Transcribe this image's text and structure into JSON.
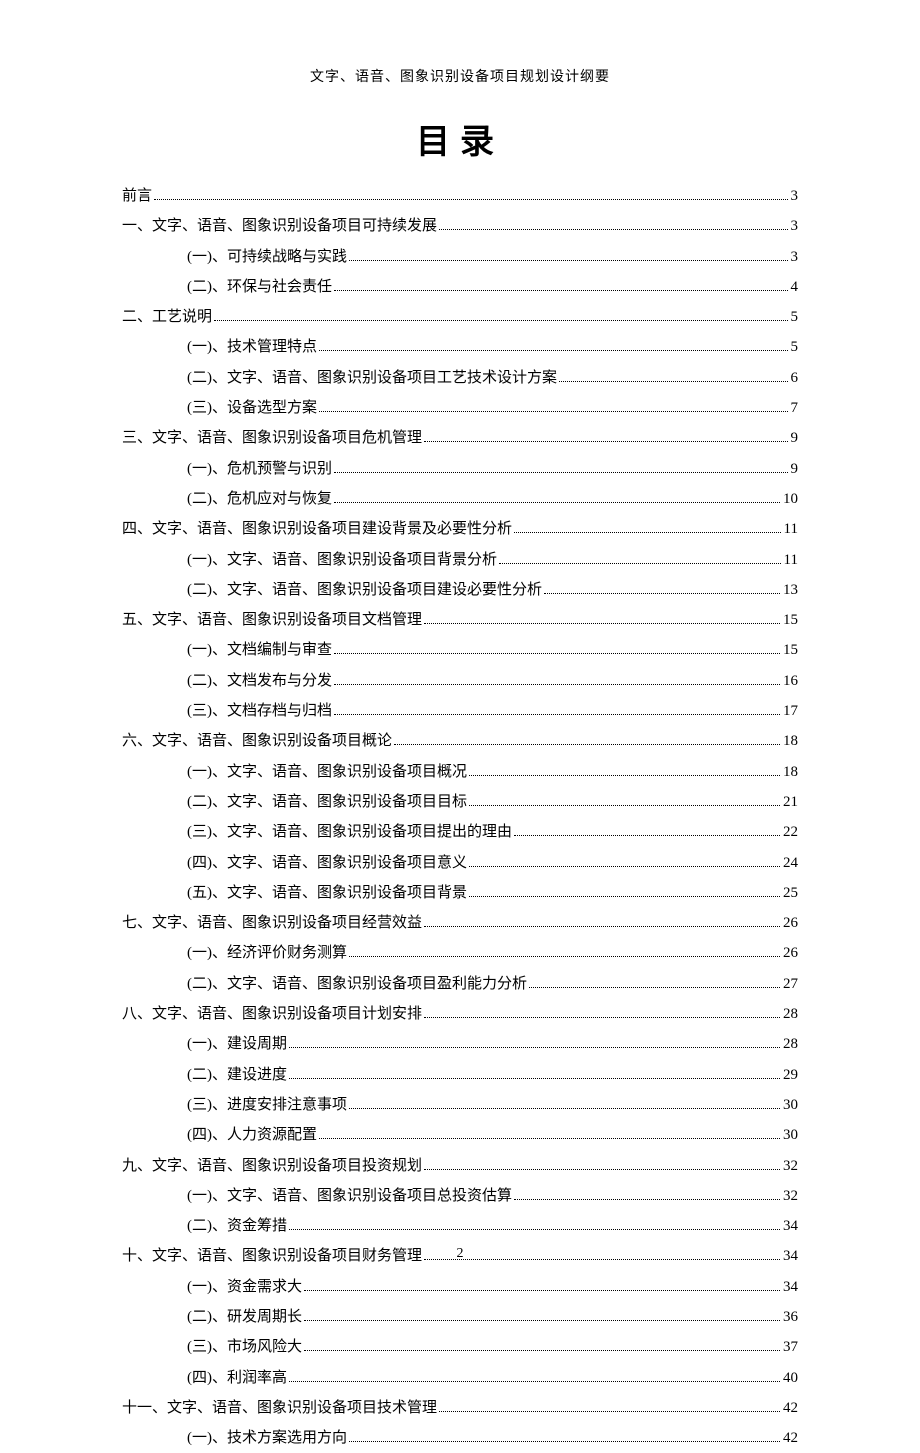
{
  "header": "文字、语音、图象识别设备项目规划设计纲要",
  "title": "目录",
  "page_number": "2",
  "toc": [
    {
      "level": 1,
      "label": "前言",
      "page": "3"
    },
    {
      "level": 1,
      "label": "一、文字、语音、图象识别设备项目可持续发展",
      "page": "3"
    },
    {
      "level": 2,
      "label": "(一)、可持续战略与实践",
      "page": "3"
    },
    {
      "level": 2,
      "label": "(二)、环保与社会责任",
      "page": "4"
    },
    {
      "level": 1,
      "label": "二、工艺说明",
      "page": "5"
    },
    {
      "level": 2,
      "label": "(一)、技术管理特点",
      "page": "5"
    },
    {
      "level": 2,
      "label": "(二)、文字、语音、图象识别设备项目工艺技术设计方案",
      "page": "6"
    },
    {
      "level": 2,
      "label": "(三)、设备选型方案",
      "page": "7"
    },
    {
      "level": 1,
      "label": "三、文字、语音、图象识别设备项目危机管理",
      "page": "9"
    },
    {
      "level": 2,
      "label": "(一)、危机预警与识别",
      "page": "9"
    },
    {
      "level": 2,
      "label": "(二)、危机应对与恢复",
      "page": "10"
    },
    {
      "level": 1,
      "label": "四、文字、语音、图象识别设备项目建设背景及必要性分析",
      "page": "11"
    },
    {
      "level": 2,
      "label": "(一)、文字、语音、图象识别设备项目背景分析",
      "page": "11"
    },
    {
      "level": 2,
      "label": "(二)、文字、语音、图象识别设备项目建设必要性分析",
      "page": "13"
    },
    {
      "level": 1,
      "label": "五、文字、语音、图象识别设备项目文档管理",
      "page": "15"
    },
    {
      "level": 2,
      "label": "(一)、文档编制与审查",
      "page": "15"
    },
    {
      "level": 2,
      "label": "(二)、文档发布与分发",
      "page": "16"
    },
    {
      "level": 2,
      "label": "(三)、文档存档与归档",
      "page": "17"
    },
    {
      "level": 1,
      "label": "六、文字、语音、图象识别设备项目概论",
      "page": "18"
    },
    {
      "level": 2,
      "label": "(一)、文字、语音、图象识别设备项目概况",
      "page": "18"
    },
    {
      "level": 2,
      "label": "(二)、文字、语音、图象识别设备项目目标",
      "page": "21"
    },
    {
      "level": 2,
      "label": "(三)、文字、语音、图象识别设备项目提出的理由",
      "page": "22"
    },
    {
      "level": 2,
      "label": "(四)、文字、语音、图象识别设备项目意义",
      "page": "24"
    },
    {
      "level": 2,
      "label": "(五)、文字、语音、图象识别设备项目背景",
      "page": "25"
    },
    {
      "level": 1,
      "label": "七、文字、语音、图象识别设备项目经营效益",
      "page": "26"
    },
    {
      "level": 2,
      "label": "(一)、经济评价财务测算",
      "page": "26"
    },
    {
      "level": 2,
      "label": "(二)、文字、语音、图象识别设备项目盈利能力分析",
      "page": "27"
    },
    {
      "level": 1,
      "label": "八、文字、语音、图象识别设备项目计划安排",
      "page": "28"
    },
    {
      "level": 2,
      "label": "(一)、建设周期",
      "page": "28"
    },
    {
      "level": 2,
      "label": "(二)、建设进度",
      "page": "29"
    },
    {
      "level": 2,
      "label": "(三)、进度安排注意事项",
      "page": "30"
    },
    {
      "level": 2,
      "label": "(四)、人力资源配置",
      "page": "30"
    },
    {
      "level": 1,
      "label": "九、文字、语音、图象识别设备项目投资规划",
      "page": "32"
    },
    {
      "level": 2,
      "label": "(一)、文字、语音、图象识别设备项目总投资估算",
      "page": "32"
    },
    {
      "level": 2,
      "label": "(二)、资金筹措",
      "page": "34"
    },
    {
      "level": 1,
      "label": "十、文字、语音、图象识别设备项目财务管理",
      "page": "34"
    },
    {
      "level": 2,
      "label": "(一)、资金需求大",
      "page": "34"
    },
    {
      "level": 2,
      "label": "(二)、研发周期长",
      "page": "36"
    },
    {
      "level": 2,
      "label": "(三)、市场风险大",
      "page": "37"
    },
    {
      "level": 2,
      "label": "(四)、利润率高",
      "page": "40"
    },
    {
      "level": 1,
      "label": "十一、文字、语音、图象识别设备项目技术管理",
      "page": "42"
    },
    {
      "level": 2,
      "label": "(一)、技术方案选用方向",
      "page": "42"
    }
  ]
}
